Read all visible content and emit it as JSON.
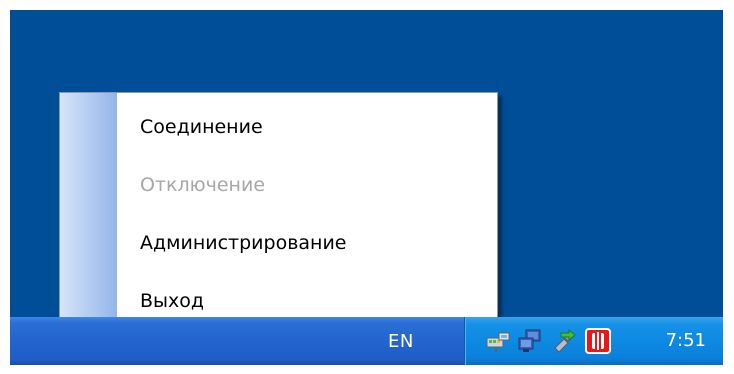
{
  "menu": {
    "items": [
      {
        "label": "Соединение",
        "enabled": true
      },
      {
        "label": "Отключение",
        "enabled": false
      },
      {
        "label": "Администрирование",
        "enabled": true
      },
      {
        "label": "Выход",
        "enabled": true
      }
    ]
  },
  "taskbar": {
    "language": "EN",
    "clock": "7:51",
    "tray_icons": [
      "network-adapter-icon",
      "network-computers-icon",
      "safely-remove-hardware-icon",
      "red-app-tray-icon"
    ]
  },
  "colors": {
    "desktop": "#004e98",
    "taskbar": "#2364cf",
    "tray": "#0d8ae3",
    "menu_disabled_text": "#a7a7a7",
    "tray_app_red": "#e8181a"
  }
}
